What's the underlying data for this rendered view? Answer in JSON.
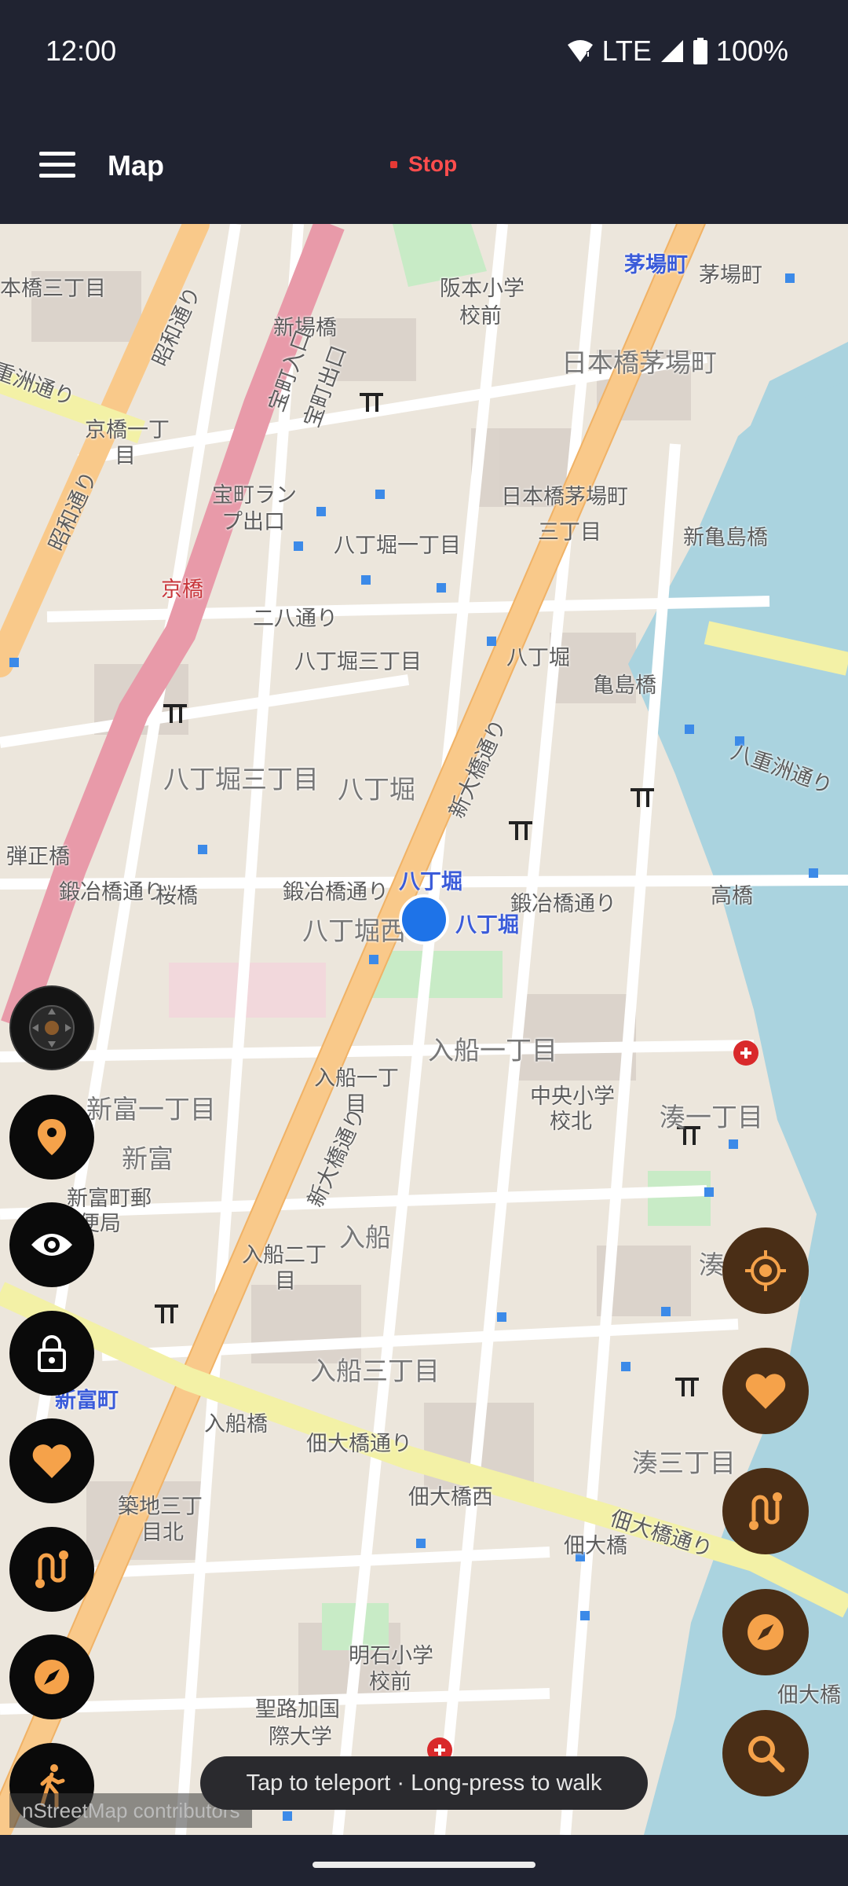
{
  "status_bar": {
    "time": "12:00",
    "network": "LTE",
    "battery": "100%",
    "icons": [
      "wifi-icon",
      "signal-icon",
      "battery-icon"
    ]
  },
  "app_bar": {
    "title": "Map",
    "stop_label": "Stop",
    "menu_icon": "hamburger-menu-icon"
  },
  "map": {
    "labels": [
      {
        "text": "本橋三丁目"
      },
      {
        "text": "新場橋"
      },
      {
        "text": "阪本小学"
      },
      {
        "text": "校前"
      },
      {
        "text": "茅場町"
      },
      {
        "text": "茅場町"
      },
      {
        "text": "日本橋茅場町"
      },
      {
        "text": "京橋一丁"
      },
      {
        "text": "目"
      },
      {
        "text": "宝町ラン"
      },
      {
        "text": "プ出口"
      },
      {
        "text": "日本橋茅場町"
      },
      {
        "text": "三丁目"
      },
      {
        "text": "新亀島橋"
      },
      {
        "text": "八丁堀一丁目"
      },
      {
        "text": "京橋"
      },
      {
        "text": "二八通り"
      },
      {
        "text": "八丁堀"
      },
      {
        "text": "八丁堀三丁目"
      },
      {
        "text": "亀島橋"
      },
      {
        "text": "八丁堀三丁目"
      },
      {
        "text": "八丁堀"
      },
      {
        "text": "弾正橋"
      },
      {
        "text": "鍛冶橋通り"
      },
      {
        "text": "桜橋"
      },
      {
        "text": "鍛冶橋通り"
      },
      {
        "text": "八丁堀"
      },
      {
        "text": "鍛冶橋通り"
      },
      {
        "text": "高橋"
      },
      {
        "text": "八丁堀西"
      },
      {
        "text": "八丁堀"
      },
      {
        "text": "入船一丁目"
      },
      {
        "text": "入船一丁"
      },
      {
        "text": "目"
      },
      {
        "text": "中央小学"
      },
      {
        "text": "校北"
      },
      {
        "text": "新富一丁目"
      },
      {
        "text": "湊一丁目"
      },
      {
        "text": "新富"
      },
      {
        "text": "新富町郵"
      },
      {
        "text": "便局"
      },
      {
        "text": "入船"
      },
      {
        "text": "入船二丁"
      },
      {
        "text": "目"
      },
      {
        "text": "湊"
      },
      {
        "text": "入船三丁目"
      },
      {
        "text": "入船橋"
      },
      {
        "text": "佃大橋通り"
      },
      {
        "text": "新富町"
      },
      {
        "text": "湊三丁目"
      },
      {
        "text": "佃大橋西"
      },
      {
        "text": "佃大橋"
      },
      {
        "text": "築地三丁"
      },
      {
        "text": "目北"
      },
      {
        "text": "明石小学"
      },
      {
        "text": "校前"
      },
      {
        "text": "聖路加国"
      },
      {
        "text": "際大学"
      },
      {
        "text": "佃大橋"
      },
      {
        "text": "新大橋通り"
      },
      {
        "text": "新大橋通り"
      },
      {
        "text": "昭和通り"
      },
      {
        "text": "昭和通り"
      },
      {
        "text": "重洲通り"
      },
      {
        "text": "八重洲通り"
      },
      {
        "text": "宝町入口"
      },
      {
        "text": "宝町出口"
      },
      {
        "text": "佃大橋通り"
      }
    ],
    "current_location_marker": "blue-location-dot"
  },
  "left_fabs": [
    {
      "name": "gps-joystick-button",
      "icon": "joystick-icon"
    },
    {
      "name": "pin-button",
      "icon": "map-pin-icon"
    },
    {
      "name": "visibility-button",
      "icon": "eye-icon"
    },
    {
      "name": "lock-button",
      "icon": "lock-icon"
    },
    {
      "name": "favorite-button",
      "icon": "heart-icon"
    },
    {
      "name": "route-button",
      "icon": "route-icon"
    },
    {
      "name": "compass-button",
      "icon": "compass-icon"
    },
    {
      "name": "walk-button",
      "icon": "walk-icon"
    }
  ],
  "right_fabs": [
    {
      "name": "my-location-button",
      "icon": "crosshair-icon"
    },
    {
      "name": "favorites-button",
      "icon": "heart-icon"
    },
    {
      "name": "routes-button",
      "icon": "route-icon"
    },
    {
      "name": "navigate-button",
      "icon": "compass-icon"
    },
    {
      "name": "search-button",
      "icon": "search-icon"
    }
  ],
  "toast": {
    "text": "Tap to teleport · Long-press to walk"
  },
  "attribution": {
    "text": "nStreetMap contributors"
  },
  "colors": {
    "accent_orange": "#f5a24a",
    "fab_right_bg": "#4a2e16",
    "fab_left_bg": "#0a0a0a",
    "stop_red": "#ff4d4d",
    "app_bar_bg": "#202331",
    "location_blue": "#1e73e8"
  }
}
